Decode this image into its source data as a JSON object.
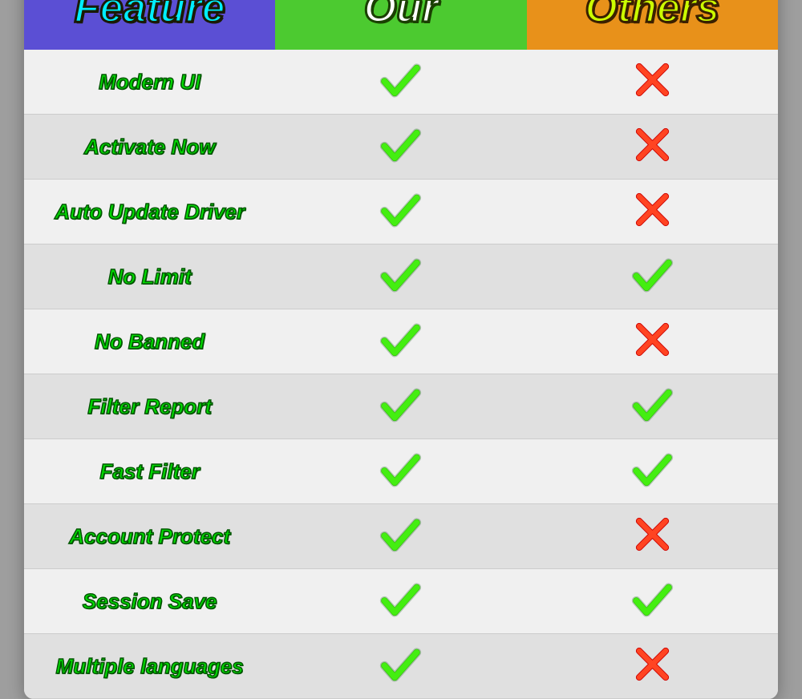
{
  "header": {
    "feature_label": "Feature",
    "our_label": "Our",
    "others_label": "Others"
  },
  "rows": [
    {
      "feature": "Modern UI",
      "our": "check",
      "others": "cross"
    },
    {
      "feature": "Activate Now",
      "our": "check",
      "others": "cross"
    },
    {
      "feature": "Auto Update Driver",
      "our": "check",
      "others": "cross"
    },
    {
      "feature": "No Limit",
      "our": "check",
      "others": "check"
    },
    {
      "feature": "No Banned",
      "our": "check",
      "others": "cross"
    },
    {
      "feature": "Filter Report",
      "our": "check",
      "others": "check"
    },
    {
      "feature": "Fast Filter",
      "our": "check",
      "others": "check"
    },
    {
      "feature": "Account Protect",
      "our": "check",
      "others": "cross"
    },
    {
      "feature": "Session Save",
      "our": "check",
      "others": "check"
    },
    {
      "feature": "Multiple languages",
      "our": "check",
      "others": "cross"
    }
  ]
}
